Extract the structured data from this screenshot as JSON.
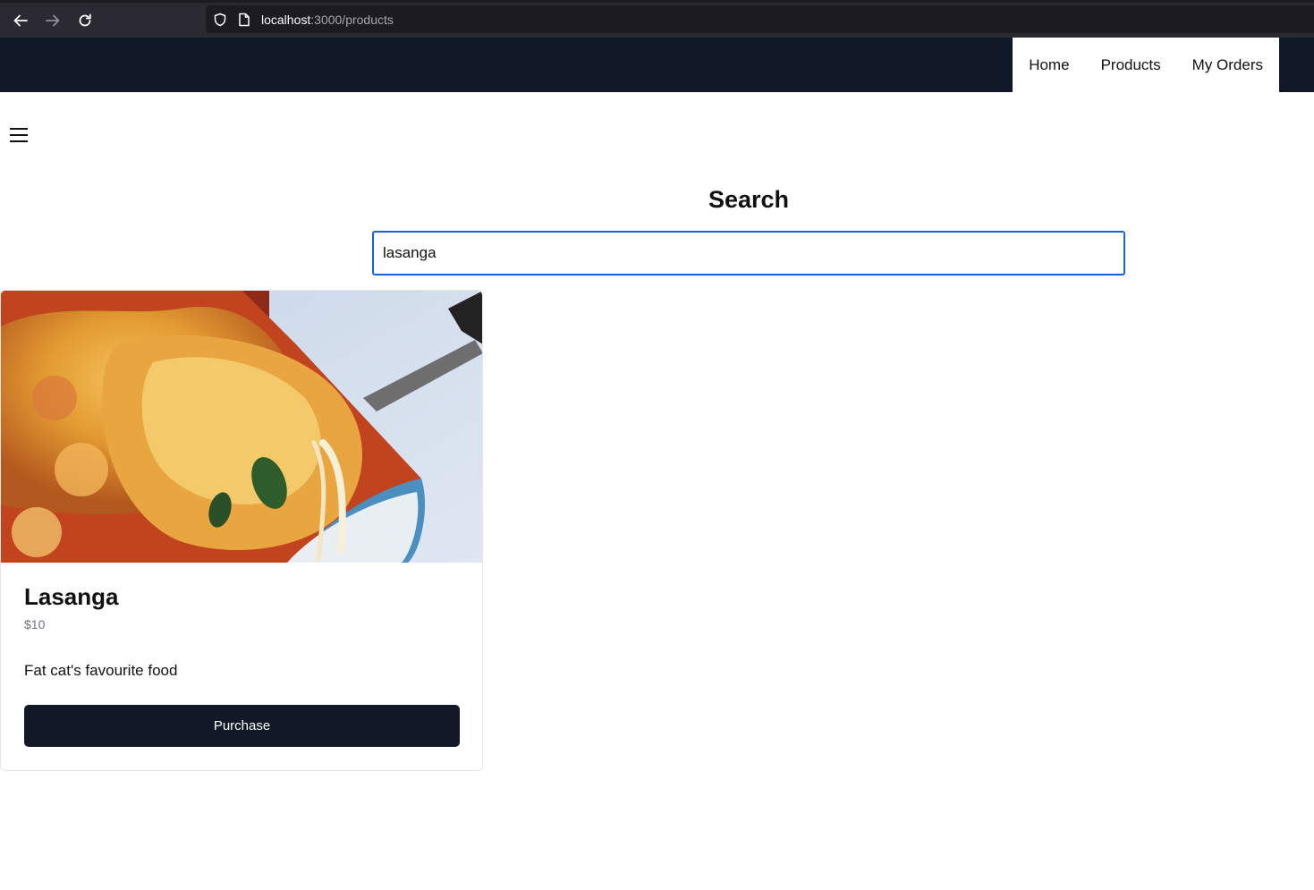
{
  "browser": {
    "url_host": "localhost",
    "url_path": ":3000/products",
    "icons": [
      "back-arrow-icon",
      "forward-arrow-icon",
      "reload-icon",
      "shield-icon",
      "page-icon"
    ]
  },
  "nav": {
    "items": [
      {
        "label": "Home"
      },
      {
        "label": "Products"
      },
      {
        "label": "My Orders"
      }
    ]
  },
  "search": {
    "title": "Search",
    "value": "lasanga"
  },
  "product": {
    "name": "Lasanga",
    "price": "$10",
    "description": "Fat cat's favourite food",
    "button_label": "Purchase"
  },
  "colors": {
    "header_bg": "#111827",
    "button_bg": "#111827",
    "focus_border": "#1565d8",
    "price_text": "#6b7280"
  }
}
